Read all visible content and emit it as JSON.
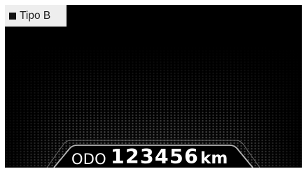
{
  "tag": {
    "label": "■ Tipo B",
    "text": "Tipo B"
  },
  "odometer": {
    "label": "ODO",
    "value": "123456",
    "unit": "km"
  },
  "colors": {
    "background": "#000000",
    "text": "#ffffff",
    "tag_background": "#eeeeee"
  }
}
